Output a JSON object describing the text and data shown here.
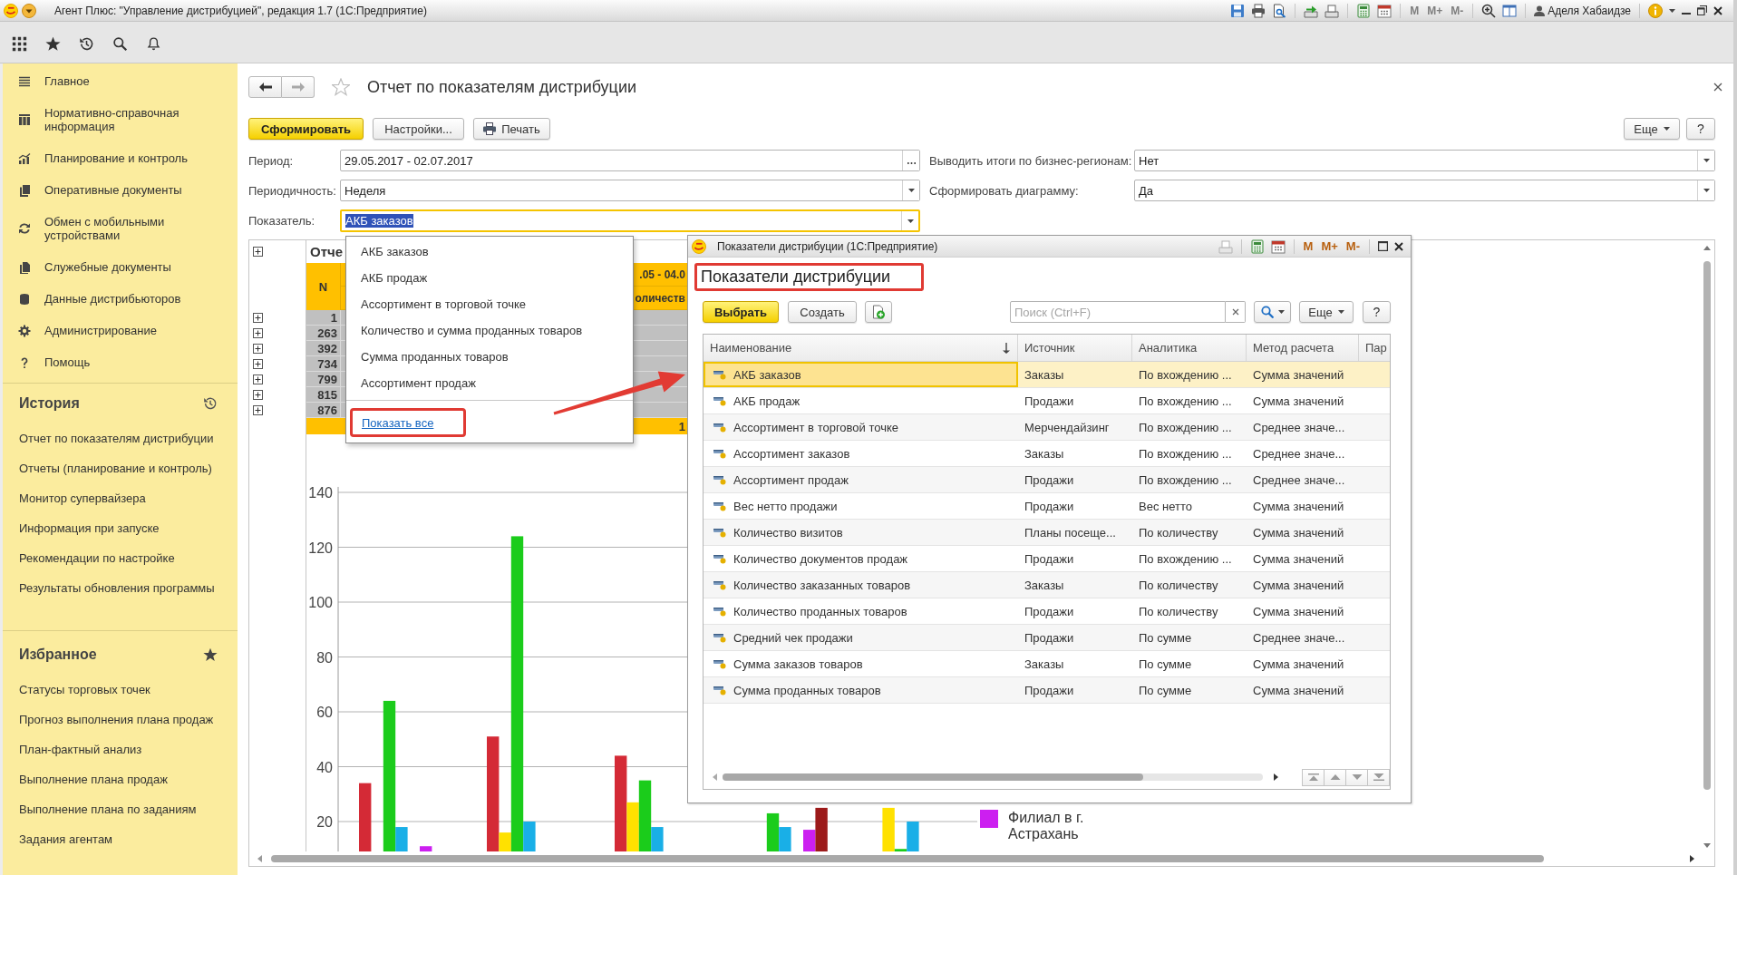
{
  "window": {
    "title": "Агент Плюс: \"Управление дистрибуцией\", редакция 1.7 (1С:Предприятие)",
    "memory_buttons": [
      {
        "label": "M",
        "disabled": true
      },
      {
        "label": "M+",
        "disabled": true
      },
      {
        "label": "M-",
        "disabled": true
      }
    ],
    "user": "Аделя Хабаидзе"
  },
  "sidebar": {
    "sections": [
      {
        "label": "Главное",
        "selected": false
      },
      {
        "label": "Нормативно-справочная информация",
        "selected": false
      },
      {
        "label": "Планирование и контроль",
        "selected": false
      },
      {
        "label": "Оперативные документы",
        "selected": false
      },
      {
        "label": "Обмен с мобильными устройствами",
        "selected": false
      },
      {
        "label": "Служебные документы",
        "selected": false
      },
      {
        "label": "Данные дистрибьюторов",
        "selected": false
      },
      {
        "label": "Администрирование",
        "selected": false
      },
      {
        "label": "Помощь",
        "selected": false
      }
    ],
    "history": {
      "title": "История",
      "items": [
        "Отчет по показателям дистрибуции",
        "Отчеты (планирование и контроль)",
        "Монитор супервайзера",
        "Информация при запуске",
        "Рекомендации по настройке",
        "Результаты обновления программы"
      ]
    },
    "favorites": {
      "title": "Избранное",
      "items": [
        "Статусы торговых точек",
        "Прогноз выполнения плана продаж",
        "План-фактный анализ",
        "Выполнение плана продаж",
        "Выполнение плана по заданиям",
        "Задания агентам"
      ]
    }
  },
  "form": {
    "navigation": {
      "back_disabled": false,
      "forward_disabled": true
    },
    "favorite": false,
    "title": "Отчет по показателям дистрибуции",
    "commands": [
      {
        "label": "Сформировать",
        "kind": "primary"
      },
      {
        "label": "Настройки...",
        "kind": "plain"
      },
      {
        "label": "Печать",
        "kind": "print"
      }
    ],
    "more": "Еще",
    "help": "?",
    "fields": [
      [
        {
          "label": "Период:",
          "value": "29.05.2017 - 02.07.2017",
          "kind": "choice",
          "focused": false
        },
        {
          "label": "Выводить итоги по бизнес-регионам:",
          "value": "Нет",
          "kind": "list",
          "focused": false
        }
      ],
      [
        {
          "label": "Периодичность:",
          "value": "Неделя",
          "kind": "list",
          "focused": false
        },
        {
          "label": "Сформировать диаграмму:",
          "value": "Да",
          "kind": "list",
          "focused": false
        }
      ],
      [
        {
          "label": "Показатель:",
          "value": "АКБ заказов",
          "kind": "list",
          "focused": true
        }
      ]
    ]
  },
  "report": {
    "outline_expanded": false,
    "heading": "Отче",
    "n_header": "N",
    "period_header": ".05 - 04.0",
    "measure_header": "оличеств",
    "rows": [
      {
        "n": "1",
        "expanded": false
      },
      {
        "n": "263",
        "expanded": false
      },
      {
        "n": "392",
        "expanded": false
      },
      {
        "n": "734",
        "expanded": false
      },
      {
        "n": "799",
        "expanded": false
      },
      {
        "n": "815",
        "expanded": false
      },
      {
        "n": "876",
        "expanded": false
      }
    ],
    "total": "1",
    "chart_data": {
      "type": "bar",
      "ylim": [
        9,
        142
      ],
      "yticks": [
        20,
        40,
        60,
        80,
        100,
        120,
        140
      ],
      "grid": true,
      "series": [
        {
          "color": "#d42a36",
          "values": [
            34,
            51,
            44,
            null,
            null
          ]
        },
        {
          "color": "#ffe100",
          "values": [
            null,
            16,
            27,
            null,
            25
          ]
        },
        {
          "color": "#1bcc1b",
          "values": [
            64,
            124,
            35,
            23,
            10
          ]
        },
        {
          "color": "#19afe7",
          "values": [
            18,
            20,
            18,
            18,
            20
          ]
        },
        {
          "values": [
            null,
            null,
            null,
            null,
            null
          ]
        },
        {
          "name": "Филиал в г. Астрахань",
          "color": "#cc1ff0",
          "values": [
            11,
            null,
            null,
            17,
            null
          ]
        },
        {
          "color": "#9c1a1a",
          "values": [
            null,
            null,
            null,
            25,
            null
          ]
        }
      ]
    }
  },
  "dropdown": {
    "items": [
      {
        "label": "АКБ заказов",
        "selected": false
      },
      {
        "label": "АКБ продаж",
        "selected": false
      },
      {
        "label": "Ассортимент в торговой точке",
        "selected": false
      },
      {
        "label": "Количество и сумма проданных товаров",
        "selected": false
      },
      {
        "label": "Сумма проданных товаров",
        "selected": false
      },
      {
        "label": "Ассортимент продаж",
        "selected": false
      }
    ],
    "show_all": {
      "label": "Показать все",
      "highlighted": true
    }
  },
  "dialog": {
    "window_title": "Показатели дистрибуции (1С:Предприятие)",
    "memory_buttons": [
      {
        "label": "M",
        "disabled": false
      },
      {
        "label": "M+",
        "disabled": false
      },
      {
        "label": "M-",
        "disabled": false
      }
    ],
    "title": "Показатели дистрибуции",
    "title_highlighted": true,
    "commands": [
      {
        "label": "Выбрать",
        "kind": "primary"
      },
      {
        "label": "Создать",
        "kind": "plain"
      }
    ],
    "search": {
      "placeholder": "Поиск (Ctrl+F)"
    },
    "more": "Еще",
    "help": "?",
    "table": {
      "columns": [
        {
          "label": "Наименование",
          "sorted": true
        },
        {
          "label": "Источник",
          "sorted": false
        },
        {
          "label": "Аналитика",
          "sorted": false
        },
        {
          "label": "Метод расчета",
          "sorted": false
        },
        {
          "label": "Пар",
          "sorted": false
        }
      ],
      "rows": [
        {
          "cells": [
            "АКБ заказов",
            "Заказы",
            "По вхождению ...",
            "Сумма значений"
          ],
          "selected": true
        },
        {
          "cells": [
            "АКБ продаж",
            "Продажи",
            "По вхождению ...",
            "Сумма значений"
          ],
          "selected": false
        },
        {
          "cells": [
            "Ассортимент в торговой точке",
            "Мерчендайзинг",
            "По вхождению ...",
            "Среднее значе..."
          ],
          "selected": false
        },
        {
          "cells": [
            "Ассортимент заказов",
            "Заказы",
            "По вхождению ...",
            "Среднее значе..."
          ],
          "selected": false
        },
        {
          "cells": [
            "Ассортимент продаж",
            "Продажи",
            "По вхождению ...",
            "Среднее значе..."
          ],
          "selected": false
        },
        {
          "cells": [
            "Вес нетто продажи",
            "Продажи",
            "Вес нетто",
            "Сумма значений"
          ],
          "selected": false
        },
        {
          "cells": [
            "Количество визитов",
            "Планы посеще...",
            "По количеству",
            "Сумма значений"
          ],
          "selected": false
        },
        {
          "cells": [
            "Количество документов продаж",
            "Продажи",
            "По вхождению ...",
            "Сумма значений"
          ],
          "selected": false
        },
        {
          "cells": [
            "Количество заказанных товаров",
            "Заказы",
            "По количеству",
            "Сумма значений"
          ],
          "selected": false
        },
        {
          "cells": [
            "Количество проданных товаров",
            "Продажи",
            "По количеству",
            "Сумма значений"
          ],
          "selected": false
        },
        {
          "cells": [
            "Средний чек продажи",
            "Продажи",
            "По сумме",
            "Среднее значе..."
          ],
          "selected": false
        },
        {
          "cells": [
            "Сумма заказов товаров",
            "Заказы",
            "По сумме",
            "Сумма значений"
          ],
          "selected": false
        },
        {
          "cells": [
            "Сумма проданных товаров",
            "Продажи",
            "По сумме",
            "Сумма значений"
          ],
          "selected": false
        }
      ]
    }
  }
}
